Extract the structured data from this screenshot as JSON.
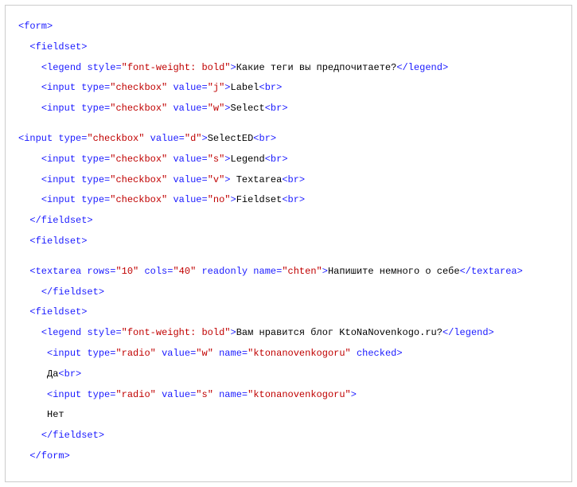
{
  "lines": [
    {
      "indent": 0,
      "segs": [
        [
          "kw",
          "<form>"
        ]
      ]
    },
    {
      "indent": 2,
      "segs": [
        [
          "kw",
          "<fieldset>"
        ]
      ]
    },
    {
      "indent": 4,
      "segs": [
        [
          "kw",
          "<legend"
        ],
        [
          "txt",
          " "
        ],
        [
          "kw",
          "style="
        ],
        [
          "str",
          "\"font-weight: bold\""
        ],
        [
          "kw",
          ">"
        ],
        [
          "txt",
          "Какие теги вы предпочитаете?"
        ],
        [
          "kw",
          "</legend>"
        ]
      ]
    },
    {
      "indent": 4,
      "segs": [
        [
          "kw",
          "<input"
        ],
        [
          "txt",
          " "
        ],
        [
          "kw",
          "type="
        ],
        [
          "str",
          "\"checkbox\""
        ],
        [
          "txt",
          " "
        ],
        [
          "kw",
          "value="
        ],
        [
          "str",
          "\"j\""
        ],
        [
          "kw",
          ">"
        ],
        [
          "txt",
          "Label"
        ],
        [
          "kw",
          "<br>"
        ]
      ]
    },
    {
      "indent": 4,
      "segs": [
        [
          "kw",
          "<input"
        ],
        [
          "txt",
          " "
        ],
        [
          "kw",
          "type="
        ],
        [
          "str",
          "\"checkbox\""
        ],
        [
          "txt",
          " "
        ],
        [
          "kw",
          "value="
        ],
        [
          "str",
          "\"w\""
        ],
        [
          "kw",
          ">"
        ],
        [
          "txt",
          "Select"
        ],
        [
          "kw",
          "<br>"
        ]
      ]
    },
    {
      "blank": true
    },
    {
      "indent": 0,
      "segs": [
        [
          "kw",
          "<input"
        ],
        [
          "txt",
          " "
        ],
        [
          "kw",
          "type="
        ],
        [
          "str",
          "\"checkbox\""
        ],
        [
          "txt",
          " "
        ],
        [
          "kw",
          "value="
        ],
        [
          "str",
          "\"d\""
        ],
        [
          "kw",
          ">"
        ],
        [
          "txt",
          "SelectED"
        ],
        [
          "kw",
          "<br>"
        ]
      ]
    },
    {
      "indent": 4,
      "segs": [
        [
          "kw",
          "<input"
        ],
        [
          "txt",
          " "
        ],
        [
          "kw",
          "type="
        ],
        [
          "str",
          "\"checkbox\""
        ],
        [
          "txt",
          " "
        ],
        [
          "kw",
          "value="
        ],
        [
          "str",
          "\"s\""
        ],
        [
          "kw",
          ">"
        ],
        [
          "txt",
          "Legend"
        ],
        [
          "kw",
          "<br>"
        ]
      ]
    },
    {
      "indent": 4,
      "segs": [
        [
          "kw",
          "<input"
        ],
        [
          "txt",
          " "
        ],
        [
          "kw",
          "type="
        ],
        [
          "str",
          "\"checkbox\""
        ],
        [
          "txt",
          " "
        ],
        [
          "kw",
          "value="
        ],
        [
          "str",
          "\"v\""
        ],
        [
          "kw",
          ">"
        ],
        [
          "txt",
          " Textarea"
        ],
        [
          "kw",
          "<br>"
        ]
      ]
    },
    {
      "indent": 4,
      "segs": [
        [
          "kw",
          "<input"
        ],
        [
          "txt",
          " "
        ],
        [
          "kw",
          "type="
        ],
        [
          "str",
          "\"checkbox\""
        ],
        [
          "txt",
          " "
        ],
        [
          "kw",
          "value="
        ],
        [
          "str",
          "\"no\""
        ],
        [
          "kw",
          ">"
        ],
        [
          "txt",
          "Fieldset"
        ],
        [
          "kw",
          "<br>"
        ]
      ]
    },
    {
      "indent": 2,
      "segs": [
        [
          "kw",
          "</fieldset>"
        ]
      ]
    },
    {
      "indent": 2,
      "segs": [
        [
          "kw",
          "<fieldset>"
        ]
      ]
    },
    {
      "blank": true
    },
    {
      "indent": 2,
      "segs": [
        [
          "kw",
          "<textarea"
        ],
        [
          "txt",
          " "
        ],
        [
          "kw",
          "rows="
        ],
        [
          "str",
          "\"10\""
        ],
        [
          "txt",
          " "
        ],
        [
          "kw",
          "cols="
        ],
        [
          "str",
          "\"40\""
        ],
        [
          "txt",
          " "
        ],
        [
          "kw",
          "readonly"
        ],
        [
          "txt",
          " "
        ],
        [
          "kw",
          "name="
        ],
        [
          "str",
          "\"chten\""
        ],
        [
          "kw",
          ">"
        ],
        [
          "txt",
          "Напишите немного о себе"
        ],
        [
          "kw",
          "</textarea>"
        ]
      ]
    },
    {
      "indent": 4,
      "segs": [
        [
          "kw",
          "</fieldset>"
        ]
      ]
    },
    {
      "indent": 2,
      "segs": [
        [
          "kw",
          "<fieldset>"
        ]
      ]
    },
    {
      "indent": 4,
      "segs": [
        [
          "kw",
          "<legend"
        ],
        [
          "txt",
          " "
        ],
        [
          "kw",
          "style="
        ],
        [
          "str",
          "\"font-weight: bold\""
        ],
        [
          "kw",
          ">"
        ],
        [
          "txt",
          "Вам нравится блог KtoNaNovenkogo.ru?"
        ],
        [
          "kw",
          "</legend>"
        ]
      ]
    },
    {
      "indent": 5,
      "segs": [
        [
          "kw",
          "<input"
        ],
        [
          "txt",
          " "
        ],
        [
          "kw",
          "type="
        ],
        [
          "str",
          "\"radio\""
        ],
        [
          "txt",
          " "
        ],
        [
          "kw",
          "value="
        ],
        [
          "str",
          "\"w\""
        ],
        [
          "txt",
          " "
        ],
        [
          "kw",
          "name="
        ],
        [
          "str",
          "\"ktonanovenkogoru\""
        ],
        [
          "txt",
          " "
        ],
        [
          "kw",
          "checked>"
        ]
      ]
    },
    {
      "indent": 5,
      "segs": [
        [
          "txt",
          "Да"
        ],
        [
          "kw",
          "<br>"
        ]
      ]
    },
    {
      "indent": 5,
      "segs": [
        [
          "kw",
          "<input"
        ],
        [
          "txt",
          " "
        ],
        [
          "kw",
          "type="
        ],
        [
          "str",
          "\"radio\""
        ],
        [
          "txt",
          " "
        ],
        [
          "kw",
          "value="
        ],
        [
          "str",
          "\"s\""
        ],
        [
          "txt",
          " "
        ],
        [
          "kw",
          "name="
        ],
        [
          "str",
          "\"ktonanovenkogoru\""
        ],
        [
          "kw",
          ">"
        ]
      ]
    },
    {
      "indent": 5,
      "segs": [
        [
          "txt",
          "Нет"
        ]
      ]
    },
    {
      "indent": 4,
      "segs": [
        [
          "kw",
          "</fieldset>"
        ]
      ]
    },
    {
      "indent": 2,
      "segs": [
        [
          "kw",
          "</form>"
        ]
      ]
    }
  ]
}
